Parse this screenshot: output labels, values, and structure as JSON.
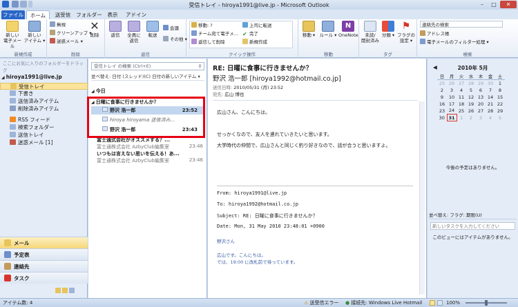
{
  "window": {
    "title": "受信トレイ - hiroya1991@live.jp - Microsoft Outlook",
    "minimize": "–",
    "maximize": "□",
    "close": "✕"
  },
  "tabs": [
    "ファイル",
    "ホーム",
    "送受信",
    "フォルダー",
    "表示",
    "アドイン"
  ],
  "ribbon": {
    "new_group": {
      "label": "新規作成",
      "new_mail": "新しい\n電子メール",
      "new_item": "新しい\nアイテム ▾"
    },
    "delete_group": {
      "label": "削除",
      "ignore": "無視",
      "cleanup": "クリーンアップ ▾",
      "junk": "迷惑メール ▾",
      "delete": "削除"
    },
    "respond_group": {
      "label": "返信",
      "reply": "返信",
      "reply_all": "全員に\n返信",
      "forward": "転送",
      "meeting": "会議",
      "more": "その他 ▾"
    },
    "quick_steps_group": {
      "label": "クイック操作",
      "items": [
        "移動: ?",
        "チーム宛て電子メ...",
        "返信して削除",
        "上司に転送",
        "完了",
        "新規作成"
      ]
    },
    "move_group": {
      "label": "移動",
      "move": "移動 ▾",
      "rules": "ルール ▾",
      "onenote": "OneNote"
    },
    "tags_group": {
      "label": "タグ",
      "unread": "未読/\n開封済み",
      "categorize": "分類 ▾",
      "followup": "フラグの\n設定 ▾"
    },
    "find_group": {
      "label": "検索",
      "search_contacts": "連絡先の検索",
      "address_book": "アドレス帳",
      "filter_email": "電子メールのフィルター処理 ▾"
    }
  },
  "nav": {
    "search_placeholder": "ここにお気に入りのフォルダーをドラッグ",
    "account": "hiroya1991@live.jp",
    "folders": [
      "受信トレイ",
      "下書き",
      "送信済みアイテム",
      "削除済みアイテム",
      "RSS フィード",
      "検索フォルダー",
      "送信トレイ",
      "迷惑メール [1]"
    ],
    "bottom": [
      "メール",
      "予定表",
      "連絡先",
      "タスク"
    ]
  },
  "list": {
    "search_placeholder": "受信トレイ の検索 (Ctrl+E)",
    "sort_label": "並べ替え: 日付 (スレッド)(C) 日付の新しいアイテム ▾",
    "group_today": "今日",
    "thread_subject": "日曜に食事に行きませんか？",
    "thread_items": [
      {
        "sender": "野沢 浩一郎",
        "time": "23:52",
        "selected": true
      },
      {
        "sender": "hiroya hiroyama",
        "extra": "送信済み...",
        "selected": false
      },
      {
        "sender": "野沢 浩一郎",
        "time": "23:43",
        "selected": false
      }
    ],
    "other_items": [
      {
        "subject": "富士通式会社がオススメする？...",
        "sender": "富士通株式会社 AzbyClub編集室",
        "time": "23:46"
      },
      {
        "subject": "いつもは言えない思いを伝える！あ...",
        "sender": "富士通株式会社 AzbyClub編集室",
        "time": "23:46"
      }
    ]
  },
  "reading": {
    "subject": "RE: 日曜に食事に行きませんか？",
    "from": "野沢 浩一郎 [hiroya1992@hotmail.co.jp]",
    "sent_label": "送信日時:",
    "sent_value": "2010/05/31 (月) 23:52",
    "to_label": "宛先:",
    "to_value": "広山 博也",
    "body_lines": [
      "広山さん、こんにちは。",
      "せっかくなので、友人を連れていきたいと思います。",
      "大学時代の仲間で、広山さんと同じく釣り好きなので、話が合うと思いますよ。"
    ],
    "quoted": {
      "from": "From: hiroya1991@live.jp",
      "to": "To: hiroya1992@hotmail.co.jp",
      "subject": "Subject: RE: 日曜に食事に行きませんか？",
      "date": "Date: Mon, 31 May 2010 23:48:01 +0900",
      "line1": "野沢さん",
      "line2": "広山です。こんにちは。",
      "line3": "では、19:00 に改札前で待っています。"
    }
  },
  "todo": {
    "month_title": "2010年 5月",
    "weekdays": [
      "日",
      "月",
      "火",
      "水",
      "木",
      "金",
      "土"
    ],
    "weeks": [
      [
        "25",
        "26",
        "27",
        "28",
        "29",
        "30",
        "1"
      ],
      [
        "2",
        "3",
        "4",
        "5",
        "6",
        "7",
        "8"
      ],
      [
        "9",
        "10",
        "11",
        "12",
        "13",
        "14",
        "15"
      ],
      [
        "16",
        "17",
        "18",
        "19",
        "20",
        "21",
        "22"
      ],
      [
        "23",
        "24",
        "25",
        "26",
        "27",
        "28",
        "29"
      ],
      [
        "30",
        "31",
        "1",
        "2",
        "3",
        "4",
        "5"
      ]
    ],
    "today": "31",
    "no_appointments": "今後の予定はありません。",
    "task_sort": "並べ替え: フラグ: 期限(U)",
    "task_input": "新しいタスクを入力してください",
    "task_empty": "このビューにはアイテムがありません。"
  },
  "status": {
    "item_count": "アイテム数: 4",
    "send_error": "送受信エラー",
    "connected": "接続先: Windows Live Hotmail",
    "zoom": "100%"
  }
}
